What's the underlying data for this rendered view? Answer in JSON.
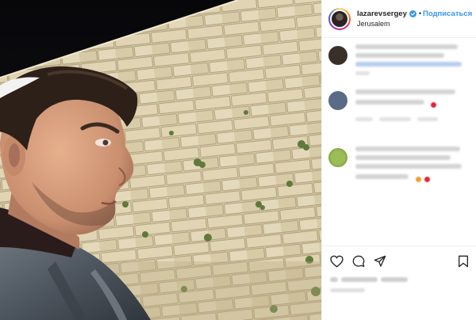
{
  "post": {
    "username": "lazarevsergey",
    "separator": "•",
    "follow_label": "Подписаться",
    "location": "Jerusalem",
    "verified_icon": "verified-badge-icon",
    "accent_color": "#3897f0"
  },
  "photo": {
    "description_icon": "post-photo"
  },
  "comments": [
    {
      "avatar_color": "#3a3028",
      "lines": 3,
      "meta": true
    },
    {
      "avatar_color": "#5a6b86",
      "lines": 2,
      "meta": true,
      "emoji_color": "#e0263b"
    },
    {
      "avatar_color": "#86a44a",
      "lines": 4,
      "meta": false,
      "emoji_color": "#f0a030"
    }
  ],
  "actions": {
    "like_icon": "heart-icon",
    "comment_icon": "comment-icon",
    "share_icon": "share-icon",
    "save_icon": "bookmark-icon"
  }
}
